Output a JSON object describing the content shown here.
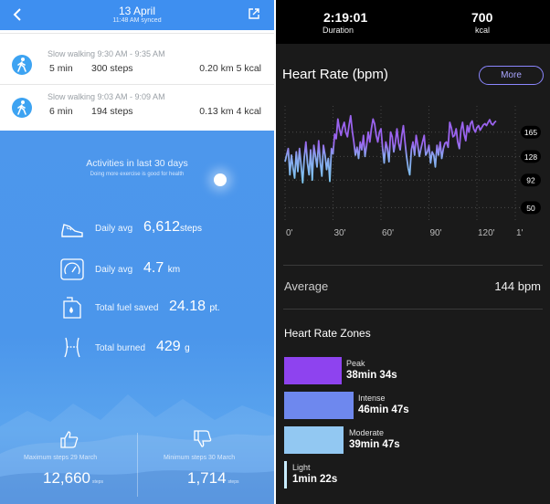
{
  "left": {
    "header": {
      "date": "13 April",
      "sync": "11:48 AM synced"
    },
    "activities": [
      {
        "title": "Slow walking 9:30 AM - 9:35 AM",
        "duration": "5  min",
        "steps": "300 steps",
        "distance": "0.20 km 5 kcal"
      },
      {
        "title": "Slow walking 9:03 AM - 9:09 AM",
        "duration": "6  min",
        "steps": "194 steps",
        "distance": "0.13 km 4 kcal"
      }
    ],
    "summary": {
      "heading": "Activities in last 30 days",
      "subheading": "Doing more exercise is good for health",
      "stats": [
        {
          "label": "Daily avg",
          "value": "6,612",
          "unit": "steps",
          "icon": "shoe-icon"
        },
        {
          "label": "Daily avg",
          "value": "4.7",
          "unit": "km",
          "icon": "speedometer-icon"
        },
        {
          "label": "Total fuel saved",
          "value": "24.18",
          "unit": "pt.",
          "icon": "fuel-can-icon"
        },
        {
          "label": "Total burned",
          "value": "429",
          "unit": "g",
          "icon": "waist-icon"
        }
      ],
      "max": {
        "label": "Maximum steps 29 March",
        "value": "12,660",
        "unit": "steps"
      },
      "min": {
        "label": "Minimum steps 30 March",
        "value": "1,714",
        "unit": "steps"
      }
    }
  },
  "right": {
    "top": {
      "duration_value": "2:19:01",
      "duration_label": "Duration",
      "kcal_value": "700",
      "kcal_label": "kcal"
    },
    "heart_rate_title": "Heart Rate (bpm)",
    "more_label": "More",
    "chart_data": {
      "type": "line",
      "title": "Heart Rate (bpm)",
      "x_tick_labels": [
        "0'",
        "30'",
        "60'",
        "90'",
        "120'",
        "1'"
      ],
      "y_tick_labels": [
        "165",
        "128",
        "92",
        "50"
      ],
      "y_ticks": [
        165,
        128,
        92,
        50
      ],
      "ylim": [
        38,
        205
      ],
      "xlim": [
        0,
        144
      ],
      "grid": true,
      "series_colors": {
        "low": "#7ec8f0",
        "high": "#9a63ee"
      },
      "x": [
        0,
        2,
        3,
        4,
        5,
        6,
        7,
        8,
        9,
        10,
        11,
        12,
        13,
        14,
        15,
        16,
        17,
        18,
        19,
        20,
        21,
        22,
        23,
        24,
        25,
        26,
        27,
        28,
        29,
        30,
        31,
        32,
        33,
        34,
        35,
        36,
        37,
        38,
        39,
        40,
        41,
        42,
        43,
        44,
        45,
        46,
        47,
        48,
        49,
        50,
        51,
        52,
        53,
        54,
        55,
        56,
        57,
        58,
        59,
        60,
        61,
        62,
        63,
        64,
        65,
        66,
        67,
        68,
        69,
        70,
        71,
        72,
        73,
        74,
        75,
        76,
        77,
        78,
        79,
        80,
        81,
        82,
        83,
        84,
        85,
        86,
        87,
        88,
        89,
        90,
        91,
        92,
        93,
        94,
        95,
        96,
        97,
        98,
        99,
        100,
        101,
        102,
        103,
        104,
        105,
        106,
        107,
        108,
        109,
        110,
        111,
        112,
        113,
        114,
        115,
        116,
        117,
        118,
        119,
        120,
        121,
        122,
        123,
        124,
        125,
        126,
        127,
        128,
        129,
        130,
        131,
        132
      ],
      "values": [
        120,
        140,
        100,
        130,
        110,
        95,
        135,
        105,
        140,
        115,
        88,
        125,
        150,
        118,
        100,
        138,
        92,
        145,
        128,
        112,
        152,
        120,
        98,
        145,
        130,
        108,
        125,
        90,
        140,
        132,
        162,
        155,
        185,
        170,
        160,
        172,
        180,
        165,
        158,
        175,
        190,
        168,
        150,
        130,
        142,
        125,
        150,
        138,
        160,
        128,
        145,
        165,
        150,
        170,
        185,
        178,
        160,
        150,
        165,
        170,
        140,
        118,
        150,
        140,
        120,
        165,
        158,
        135,
        150,
        170,
        148,
        138,
        160,
        175,
        150,
        128,
        110,
        100,
        138,
        150,
        130,
        160,
        145,
        128,
        140,
        150,
        160,
        130,
        135,
        145,
        118,
        135,
        130,
        112,
        145,
        130,
        150,
        125,
        140,
        148,
        150,
        142,
        180,
        172,
        158,
        160,
        170,
        150,
        140,
        168,
        180,
        162,
        152,
        175,
        165,
        178,
        182,
        170,
        165,
        172,
        175,
        168,
        172,
        176,
        178,
        175,
        180,
        184,
        178,
        176,
        180,
        182
      ]
    },
    "average_label": "Average",
    "average_value": "144 bpm",
    "zones_title": "Heart Rate Zones",
    "zones": [
      {
        "name": "Peak",
        "time": "38min 34s",
        "color": "#8e43ef"
      },
      {
        "name": "Intense",
        "time": "46min 47s",
        "color": "#6e88ee"
      },
      {
        "name": "Moderate",
        "time": "39min 47s",
        "color": "#92c8f2"
      },
      {
        "name": "Light",
        "time": "1min 22s",
        "color": "#c8ecff"
      }
    ]
  }
}
